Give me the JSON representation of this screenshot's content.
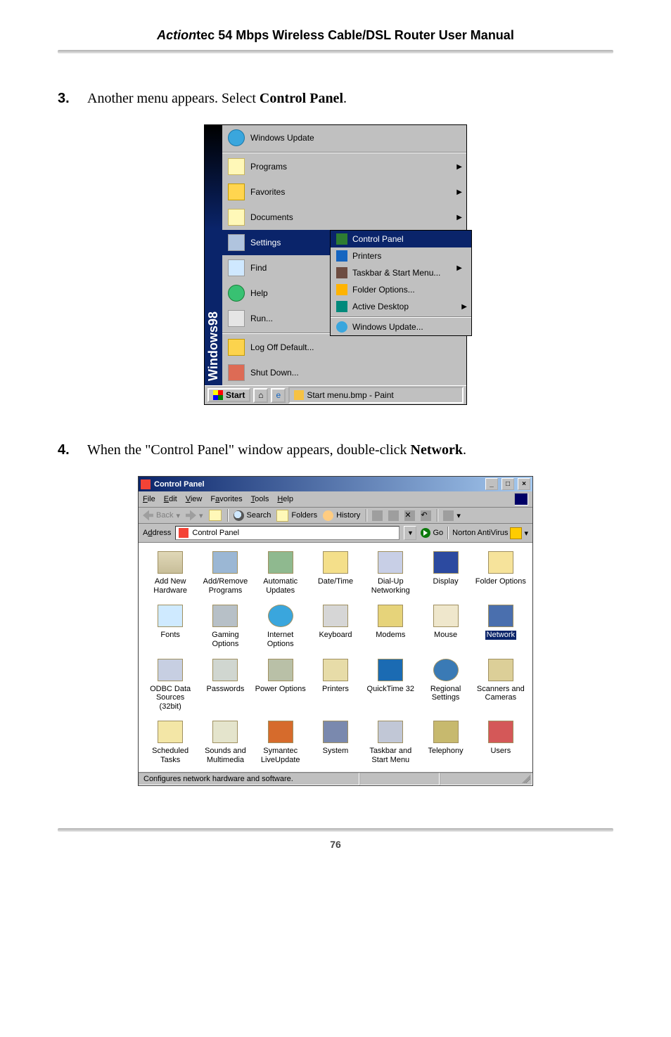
{
  "header": {
    "brand_bold": "Action",
    "brand_rest": "tec 54 Mbps Wireless Cable/DSL Router User Manual"
  },
  "steps": [
    {
      "num": "3.",
      "pre": "Another menu appears. Select ",
      "bold": "Control Panel",
      "post": "."
    },
    {
      "num": "4.",
      "pre": "When the \"Control Panel\" window appears, double-click ",
      "bold": "Network",
      "post": "."
    }
  ],
  "page_number": "76",
  "startmenu": {
    "stripe": "Windows98",
    "items": {
      "windows_update": "Windows Update",
      "programs": "Programs",
      "favorites": "Favorites",
      "documents": "Documents",
      "settings": "Settings",
      "find": "Find",
      "help": "Help",
      "run": "Run...",
      "log_off": "Log Off Default...",
      "shut_down": "Shut Down..."
    },
    "submenu": {
      "control_panel": "Control Panel",
      "printers": "Printers",
      "taskbar": "Taskbar & Start Menu...",
      "folder_options": "Folder Options...",
      "active_desktop": "Active Desktop",
      "windows_update": "Windows Update..."
    },
    "taskbar": {
      "start": "Start",
      "task_button": "Start menu.bmp - Paint"
    }
  },
  "control_panel": {
    "title": "Control Panel",
    "win_min": "_",
    "win_max": "□",
    "win_close": "×",
    "menu": {
      "file": "File",
      "edit": "Edit",
      "view": "View",
      "favorites": "Favorites",
      "tools": "Tools",
      "help": "Help"
    },
    "toolbar": {
      "back": "Back",
      "search": "Search",
      "folders": "Folders",
      "history": "History"
    },
    "address": {
      "label": "Address",
      "value": "Control Panel",
      "go": "Go",
      "norton": "Norton AntiVirus"
    },
    "items": [
      "Add New Hardware",
      "Add/Remove Programs",
      "Automatic Updates",
      "Date/Time",
      "Dial-Up Networking",
      "Display",
      "Folder Options",
      "Fonts",
      "Gaming Options",
      "Internet Options",
      "Keyboard",
      "Modems",
      "Mouse",
      "Network",
      "ODBC Data Sources (32bit)",
      "Passwords",
      "Power Options",
      "Printers",
      "QuickTime 32",
      "Regional Settings",
      "Scanners and Cameras",
      "Scheduled Tasks",
      "Sounds and Multimedia",
      "Symantec LiveUpdate",
      "System",
      "Taskbar and Start Menu",
      "Telephony",
      "Users"
    ],
    "status": "Configures network hardware and software."
  }
}
